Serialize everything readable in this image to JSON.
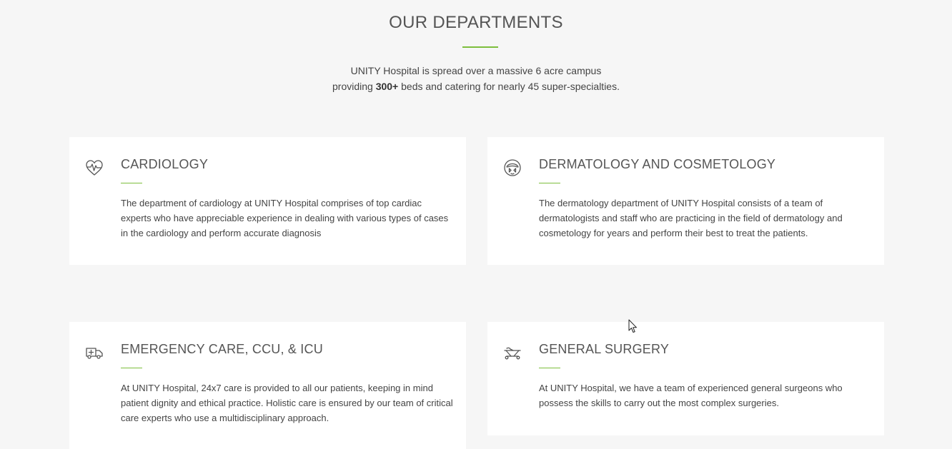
{
  "header": {
    "title": "OUR DEPARTMENTS",
    "intro_line1": "UNITY Hospital is spread over a massive 6 acre campus",
    "intro_line2_prefix": "providing ",
    "intro_line2_bold": "300+",
    "intro_line2_suffix": " beds and catering for nearly 45 super-specialties."
  },
  "accent_color": "#7dbe3c",
  "departments": [
    {
      "icon": "heart-pulse-icon",
      "title": "CARDIOLOGY",
      "description": "The department of cardiology at UNITY Hospital comprises of top cardiac experts who have appreciable experience in dealing with various types of cases in the cardiology and perform accurate diagnosis"
    },
    {
      "icon": "face-skin-icon",
      "title": "DERMATOLOGY AND COSMETOLOGY",
      "description": "The dermatology department of UNITY Hospital consists of a team of dermatologists and staff who are practicing in the field of dermatology and cosmetology for years and perform their best to treat the patients."
    },
    {
      "icon": "ambulance-icon",
      "title": "EMERGENCY CARE, CCU, & ICU",
      "description": "At UNITY Hospital, 24x7 care is provided to all our patients, keeping in mind patient dignity and ethical practice. Holistic care is ensured by our team of critical care experts who use a multidisciplinary approach."
    },
    {
      "icon": "stretcher-icon",
      "title": "GENERAL SURGERY",
      "description": "At UNITY Hospital, we have a team of experienced general surgeons who possess the skills to carry out the most complex surgeries."
    }
  ]
}
